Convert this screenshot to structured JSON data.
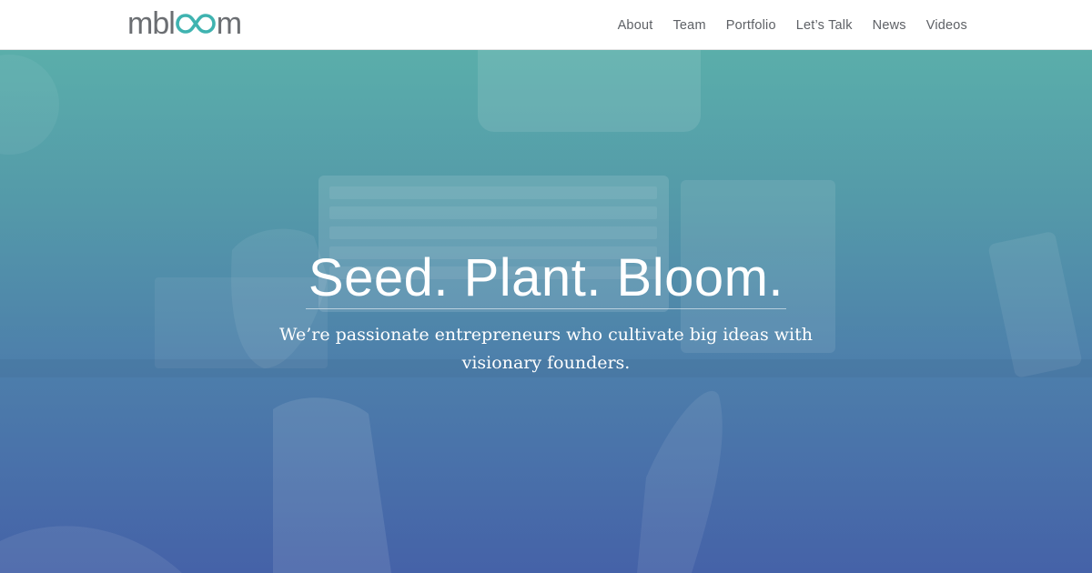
{
  "brand": {
    "logo_prefix": "mbl",
    "logo_suffix": "m",
    "logo_accent_color": "#3fb3b0",
    "logo_text_color": "#6b6e72"
  },
  "nav": {
    "items": [
      {
        "label": "About"
      },
      {
        "label": "Team"
      },
      {
        "label": "Portfolio"
      },
      {
        "label": "Let’s Talk"
      },
      {
        "label": "News"
      },
      {
        "label": "Videos"
      }
    ]
  },
  "hero": {
    "headline": "Seed. Plant. Bloom.",
    "subheadline": "We’re passionate entrepreneurs who cultivate big ideas with visionary founders.",
    "gradient_top": "#5aaeaa",
    "gradient_bottom": "#4562a8"
  }
}
